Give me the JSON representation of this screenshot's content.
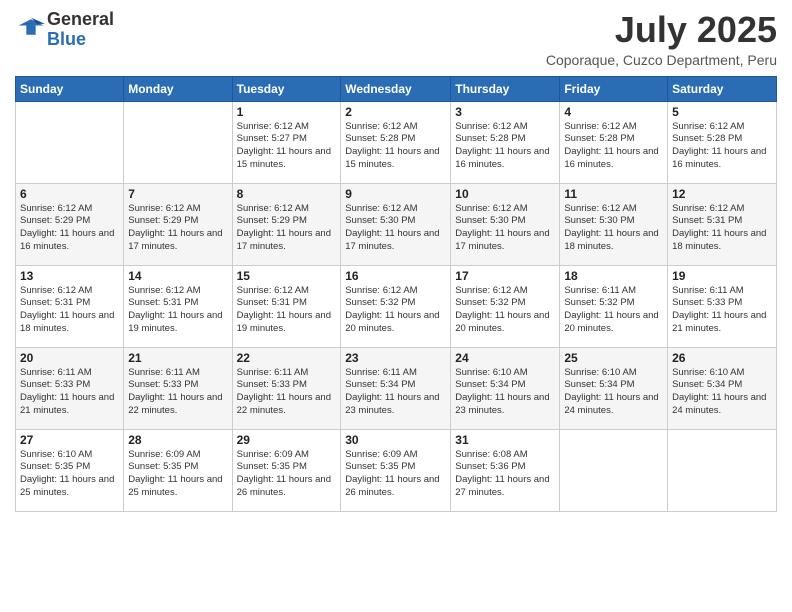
{
  "header": {
    "logo_general": "General",
    "logo_blue": "Blue",
    "month_title": "July 2025",
    "location": "Coporaque, Cuzco Department, Peru"
  },
  "weekdays": [
    "Sunday",
    "Monday",
    "Tuesday",
    "Wednesday",
    "Thursday",
    "Friday",
    "Saturday"
  ],
  "weeks": [
    [
      {
        "day": "",
        "info": ""
      },
      {
        "day": "",
        "info": ""
      },
      {
        "day": "1",
        "info": "Sunrise: 6:12 AM\nSunset: 5:27 PM\nDaylight: 11 hours and 15 minutes."
      },
      {
        "day": "2",
        "info": "Sunrise: 6:12 AM\nSunset: 5:28 PM\nDaylight: 11 hours and 15 minutes."
      },
      {
        "day": "3",
        "info": "Sunrise: 6:12 AM\nSunset: 5:28 PM\nDaylight: 11 hours and 16 minutes."
      },
      {
        "day": "4",
        "info": "Sunrise: 6:12 AM\nSunset: 5:28 PM\nDaylight: 11 hours and 16 minutes."
      },
      {
        "day": "5",
        "info": "Sunrise: 6:12 AM\nSunset: 5:28 PM\nDaylight: 11 hours and 16 minutes."
      }
    ],
    [
      {
        "day": "6",
        "info": "Sunrise: 6:12 AM\nSunset: 5:29 PM\nDaylight: 11 hours and 16 minutes."
      },
      {
        "day": "7",
        "info": "Sunrise: 6:12 AM\nSunset: 5:29 PM\nDaylight: 11 hours and 17 minutes."
      },
      {
        "day": "8",
        "info": "Sunrise: 6:12 AM\nSunset: 5:29 PM\nDaylight: 11 hours and 17 minutes."
      },
      {
        "day": "9",
        "info": "Sunrise: 6:12 AM\nSunset: 5:30 PM\nDaylight: 11 hours and 17 minutes."
      },
      {
        "day": "10",
        "info": "Sunrise: 6:12 AM\nSunset: 5:30 PM\nDaylight: 11 hours and 17 minutes."
      },
      {
        "day": "11",
        "info": "Sunrise: 6:12 AM\nSunset: 5:30 PM\nDaylight: 11 hours and 18 minutes."
      },
      {
        "day": "12",
        "info": "Sunrise: 6:12 AM\nSunset: 5:31 PM\nDaylight: 11 hours and 18 minutes."
      }
    ],
    [
      {
        "day": "13",
        "info": "Sunrise: 6:12 AM\nSunset: 5:31 PM\nDaylight: 11 hours and 18 minutes."
      },
      {
        "day": "14",
        "info": "Sunrise: 6:12 AM\nSunset: 5:31 PM\nDaylight: 11 hours and 19 minutes."
      },
      {
        "day": "15",
        "info": "Sunrise: 6:12 AM\nSunset: 5:31 PM\nDaylight: 11 hours and 19 minutes."
      },
      {
        "day": "16",
        "info": "Sunrise: 6:12 AM\nSunset: 5:32 PM\nDaylight: 11 hours and 20 minutes."
      },
      {
        "day": "17",
        "info": "Sunrise: 6:12 AM\nSunset: 5:32 PM\nDaylight: 11 hours and 20 minutes."
      },
      {
        "day": "18",
        "info": "Sunrise: 6:11 AM\nSunset: 5:32 PM\nDaylight: 11 hours and 20 minutes."
      },
      {
        "day": "19",
        "info": "Sunrise: 6:11 AM\nSunset: 5:33 PM\nDaylight: 11 hours and 21 minutes."
      }
    ],
    [
      {
        "day": "20",
        "info": "Sunrise: 6:11 AM\nSunset: 5:33 PM\nDaylight: 11 hours and 21 minutes."
      },
      {
        "day": "21",
        "info": "Sunrise: 6:11 AM\nSunset: 5:33 PM\nDaylight: 11 hours and 22 minutes."
      },
      {
        "day": "22",
        "info": "Sunrise: 6:11 AM\nSunset: 5:33 PM\nDaylight: 11 hours and 22 minutes."
      },
      {
        "day": "23",
        "info": "Sunrise: 6:11 AM\nSunset: 5:34 PM\nDaylight: 11 hours and 23 minutes."
      },
      {
        "day": "24",
        "info": "Sunrise: 6:10 AM\nSunset: 5:34 PM\nDaylight: 11 hours and 23 minutes."
      },
      {
        "day": "25",
        "info": "Sunrise: 6:10 AM\nSunset: 5:34 PM\nDaylight: 11 hours and 24 minutes."
      },
      {
        "day": "26",
        "info": "Sunrise: 6:10 AM\nSunset: 5:34 PM\nDaylight: 11 hours and 24 minutes."
      }
    ],
    [
      {
        "day": "27",
        "info": "Sunrise: 6:10 AM\nSunset: 5:35 PM\nDaylight: 11 hours and 25 minutes."
      },
      {
        "day": "28",
        "info": "Sunrise: 6:09 AM\nSunset: 5:35 PM\nDaylight: 11 hours and 25 minutes."
      },
      {
        "day": "29",
        "info": "Sunrise: 6:09 AM\nSunset: 5:35 PM\nDaylight: 11 hours and 26 minutes."
      },
      {
        "day": "30",
        "info": "Sunrise: 6:09 AM\nSunset: 5:35 PM\nDaylight: 11 hours and 26 minutes."
      },
      {
        "day": "31",
        "info": "Sunrise: 6:08 AM\nSunset: 5:36 PM\nDaylight: 11 hours and 27 minutes."
      },
      {
        "day": "",
        "info": ""
      },
      {
        "day": "",
        "info": ""
      }
    ]
  ]
}
